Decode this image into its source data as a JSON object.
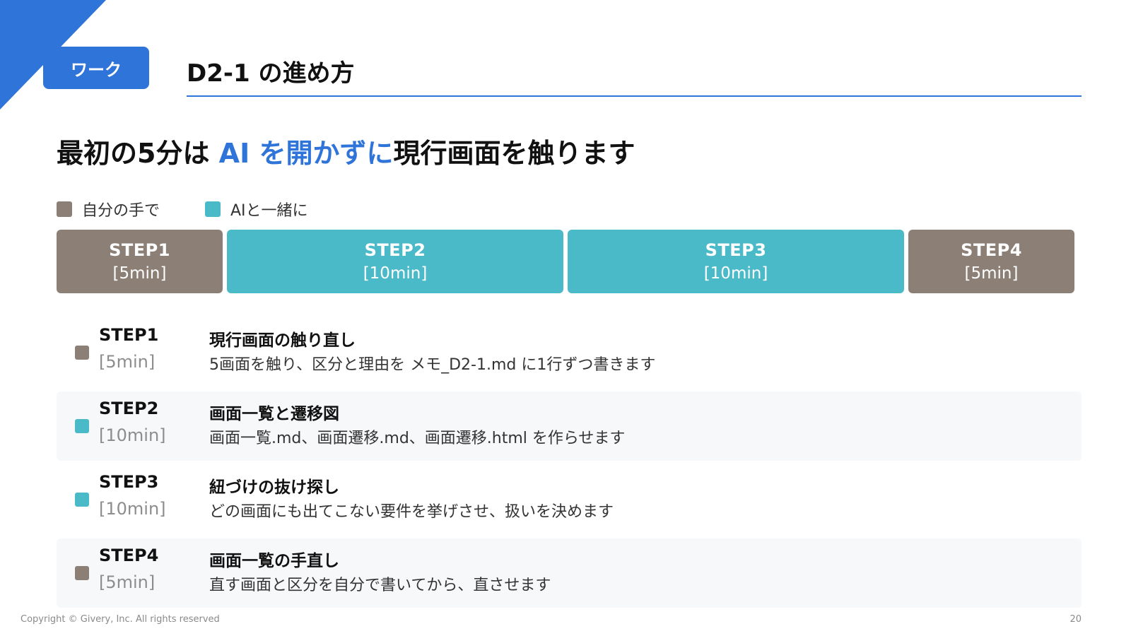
{
  "header": {
    "badge": "ワーク",
    "title": "D2-1 の進め方"
  },
  "headline": {
    "before": "最初の5分は ",
    "accent": "AI を開かずに",
    "after": "現行画面を触ります"
  },
  "legend": {
    "self": "自分の手で",
    "ai": "AIと一緒に"
  },
  "colors": {
    "accent": "#2f74d8",
    "self": "#8c7f76",
    "ai": "#4bbac8"
  },
  "timeline": [
    {
      "step": "STEP1",
      "duration": "[5min]",
      "minutes": 5,
      "mode": "self"
    },
    {
      "step": "STEP2",
      "duration": "[10min]",
      "minutes": 10,
      "mode": "ai"
    },
    {
      "step": "STEP3",
      "duration": "[10min]",
      "minutes": 10,
      "mode": "ai"
    },
    {
      "step": "STEP4",
      "duration": "[5min]",
      "minutes": 5,
      "mode": "self"
    }
  ],
  "details": [
    {
      "step": "STEP1",
      "duration": "[5min]",
      "mode": "self",
      "title": "現行画面の触り直し",
      "description": "5画面を触り、区分と理由を メモ_D2-1.md に1行ずつ書きます"
    },
    {
      "step": "STEP2",
      "duration": "[10min]",
      "mode": "ai",
      "title": "画面一覧と遷移図",
      "description": "画面一覧.md、画面遷移.md、画面遷移.html を作らせます"
    },
    {
      "step": "STEP3",
      "duration": "[10min]",
      "mode": "ai",
      "title": "紐づけの抜け探し",
      "description": "どの画面にも出てこない要件を挙げさせ、扱いを決めます"
    },
    {
      "step": "STEP4",
      "duration": "[5min]",
      "mode": "self",
      "title": "画面一覧の手直し",
      "description": "直す画面と区分を自分で書いてから、直させます"
    }
  ],
  "footer": {
    "copyright": "Copyright © Givery, Inc. All rights reserved",
    "page": "20"
  }
}
